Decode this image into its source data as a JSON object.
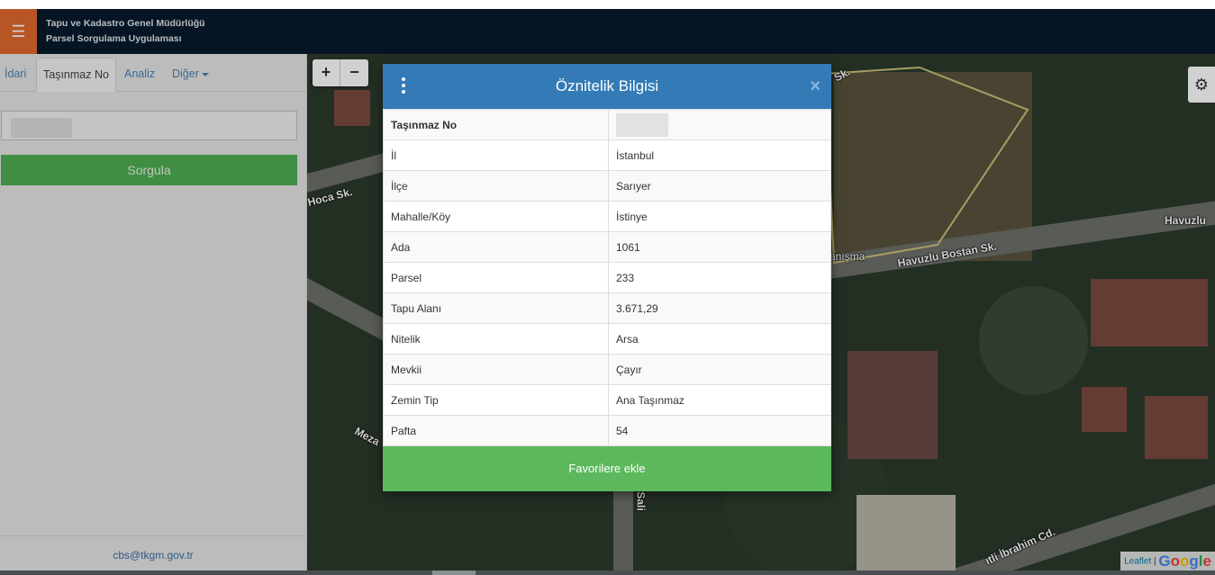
{
  "header": {
    "title_line1": "Tapu ve Kadastro Genel Müdürlüğü",
    "title_line2": "Parsel Sorgulama Uygulaması",
    "menu_icon": "hamburger-icon"
  },
  "sidebar": {
    "tabs": [
      {
        "label": "İdari"
      },
      {
        "label": "Taşınmaz No"
      },
      {
        "label": "Analiz"
      },
      {
        "label": "Diğer"
      }
    ],
    "active_tab": "Taşınmaz No",
    "search_value": "",
    "query_button": "Sorgula",
    "footer_email": "cbs@tkgm.gov.tr"
  },
  "map": {
    "zoom_in": "+",
    "zoom_out": "−",
    "gear_icon": "gear-icon",
    "labels": {
      "hoca": "Hoca Sk.",
      "havuzlu_bostan": "Havuzlu Bostan Sk.",
      "havuzlu": "Havuzlu",
      "meza": "Meza",
      "sali": "Sali",
      "ibrahim": "ıtli İbrahim Cd.",
      "sk_top": "Sk.",
      "anisma": "anışma"
    },
    "attribution_leaflet": "Leaflet",
    "attribution_sep": " | ",
    "attribution_google": "Google"
  },
  "modal": {
    "title": "Öznitelik Bilgisi",
    "close_icon": "×",
    "rows": [
      {
        "key": "Taşınmaz No",
        "value": ""
      },
      {
        "key": "İl",
        "value": "İstanbul"
      },
      {
        "key": "İlçe",
        "value": "Sarıyer"
      },
      {
        "key": "Mahalle/Köy",
        "value": "İstinye"
      },
      {
        "key": "Ada",
        "value": "1061"
      },
      {
        "key": "Parsel",
        "value": "233"
      },
      {
        "key": "Tapu Alanı",
        "value": "3.671,29"
      },
      {
        "key": "Nitelik",
        "value": "Arsa"
      },
      {
        "key": "Mevkii",
        "value": "Çayır"
      },
      {
        "key": "Zemin Tip",
        "value": "Ana Taşınmaz"
      },
      {
        "key": "Pafta",
        "value": "54"
      }
    ],
    "favorite_button": "Favorilere ekle"
  },
  "colors": {
    "header_bg": "#071a2b",
    "menu_button": "#e0692c",
    "modal_header": "#337ab7",
    "primary_green": "#5cb85c"
  }
}
